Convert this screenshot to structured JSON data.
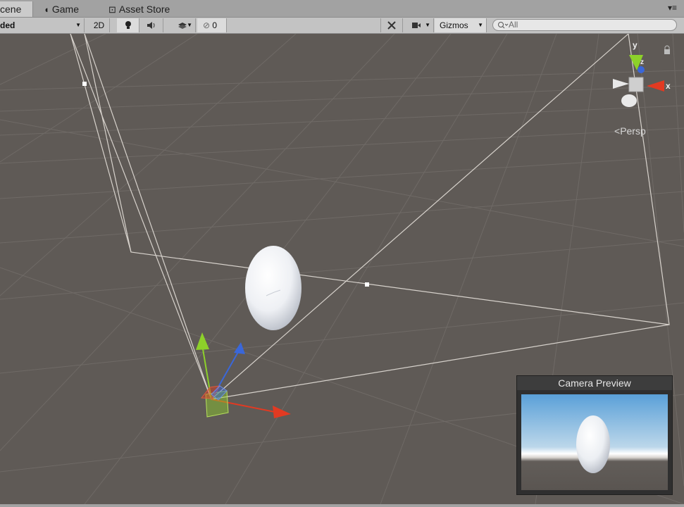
{
  "tabs": [
    {
      "label": "cene",
      "icon": "scene-icon",
      "active": true
    },
    {
      "label": "Game",
      "icon": "pacman-icon",
      "active": false
    },
    {
      "label": "Asset Store",
      "icon": "bag-icon",
      "active": false
    }
  ],
  "toolbar": {
    "shading_mode": "ded",
    "mode_2d": "2D",
    "hidden_count": "0",
    "gizmos_label": "Gizmos",
    "search_placeholder": "All"
  },
  "gizmo": {
    "x_label": "x",
    "y_label": "y",
    "z_label": "z",
    "projection": "Persp"
  },
  "camera_preview": {
    "title": "Camera Preview"
  },
  "colors": {
    "background": "#5f5a56",
    "grid": "#6e6a66",
    "x_axis": "#e23a22",
    "y_axis": "#8dd12a",
    "z_axis": "#3a67d9"
  }
}
